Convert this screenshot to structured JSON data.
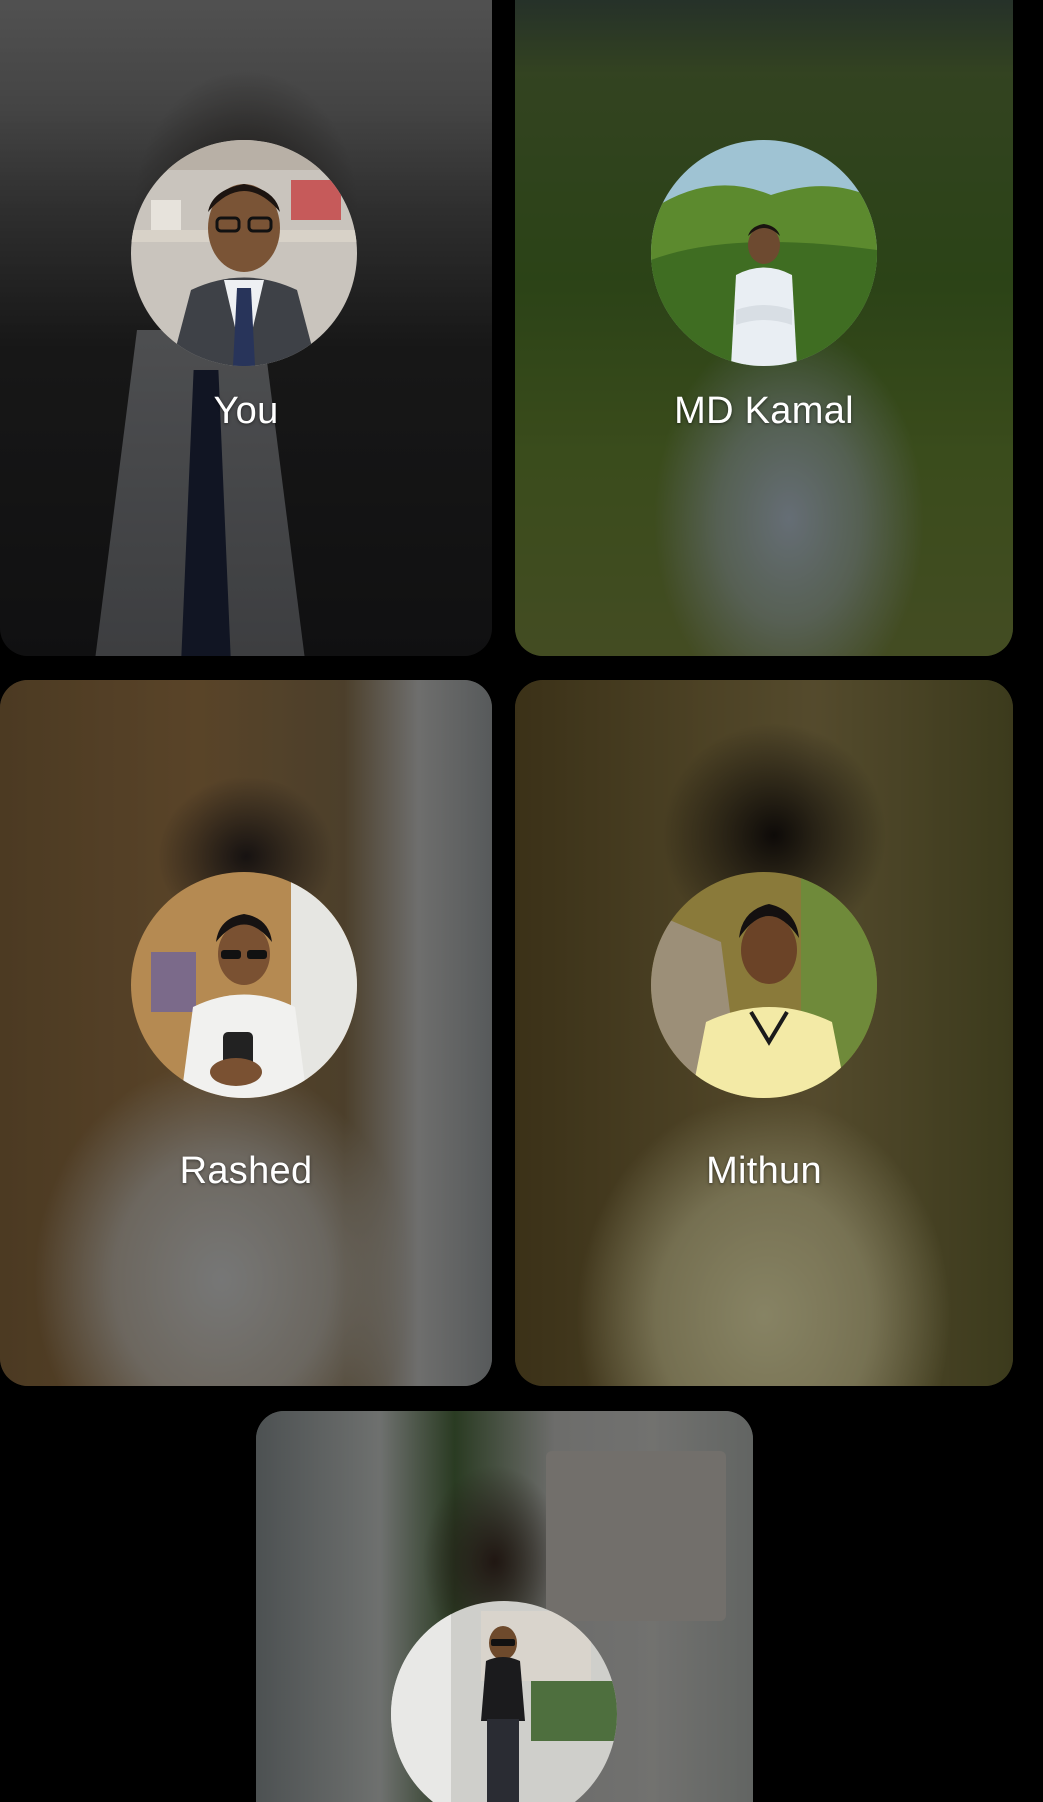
{
  "participants": [
    {
      "name": "You"
    },
    {
      "name": "MD Kamal"
    },
    {
      "name": "Rashed"
    },
    {
      "name": "Mithun"
    },
    {
      "name": ""
    }
  ]
}
